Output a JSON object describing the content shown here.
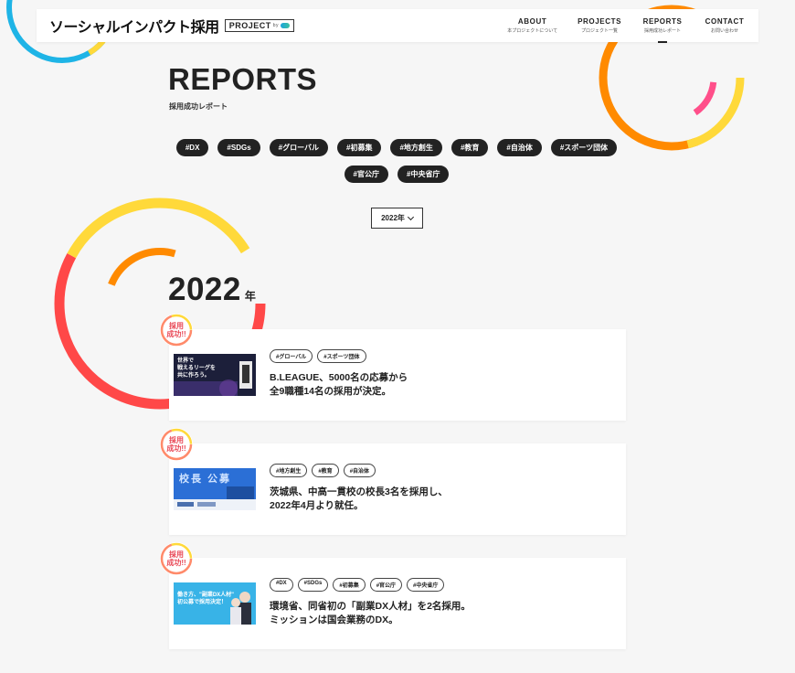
{
  "colors": {
    "background": "#f6f6f6",
    "dark": "#222222",
    "badge_red": "#e94a58",
    "ring_blue": "#1eb4e6",
    "ring_yellow": "#ffd93a",
    "ring_orange": "#ff8a00",
    "ring_pink": "#ff4f8a",
    "ring_red": "#ff4848"
  },
  "header": {
    "logo_text": "ソーシャルインパクト採用",
    "logo_badge": "PROJECT",
    "logo_badge_by": "by",
    "nav": [
      {
        "en": "ABOUT",
        "jp": "本プロジェクトについて",
        "active": false
      },
      {
        "en": "PROJECTS",
        "jp": "プロジェクト一覧",
        "active": false
      },
      {
        "en": "REPORTS",
        "jp": "採用成功レポート",
        "active": true
      },
      {
        "en": "CONTACT",
        "jp": "お問い合わせ",
        "active": false
      }
    ]
  },
  "page": {
    "title": "REPORTS",
    "subtitle": "採用成功レポート"
  },
  "tags": [
    "#DX",
    "#SDGs",
    "#グローバル",
    "#初募集",
    "#地方創生",
    "#教育",
    "#自治体",
    "#スポーツ団体",
    "#官公庁",
    "#中央省庁"
  ],
  "year_select": {
    "value": "2022年"
  },
  "year_heading": {
    "year": "2022",
    "unit": "年"
  },
  "badge": {
    "line1": "採用",
    "line2": "成功!!"
  },
  "reports": [
    {
      "tags": [
        "#グローバル",
        "#スポーツ団体"
      ],
      "title": "B.LEAGUE、5000名の応募から\n全9職種14名の採用が決定。",
      "thumb_icon": "bleague-thumbnail",
      "thumb_text": "世界で\n戦えるリーグを\n共に作ろう。"
    },
    {
      "tags": [
        "#地方創生",
        "#教育",
        "#自治体"
      ],
      "title": "茨城県、中高一貫校の校長3名を採用し、\n2022年4月より就任。",
      "thumb_icon": "ibaraki-thumbnail",
      "thumb_text": "校長 公募"
    },
    {
      "tags": [
        "#DX",
        "#SDGs",
        "#初募集",
        "#官公庁",
        "#中央省庁"
      ],
      "title": "環境省、同省初の「副業DX人材」を2名採用。\nミッションは国会業務のDX。",
      "thumb_icon": "env-ministry-thumbnail",
      "thumb_text": "働き方、\"副業DX人材\"\n初公募で採用決定！"
    }
  ]
}
